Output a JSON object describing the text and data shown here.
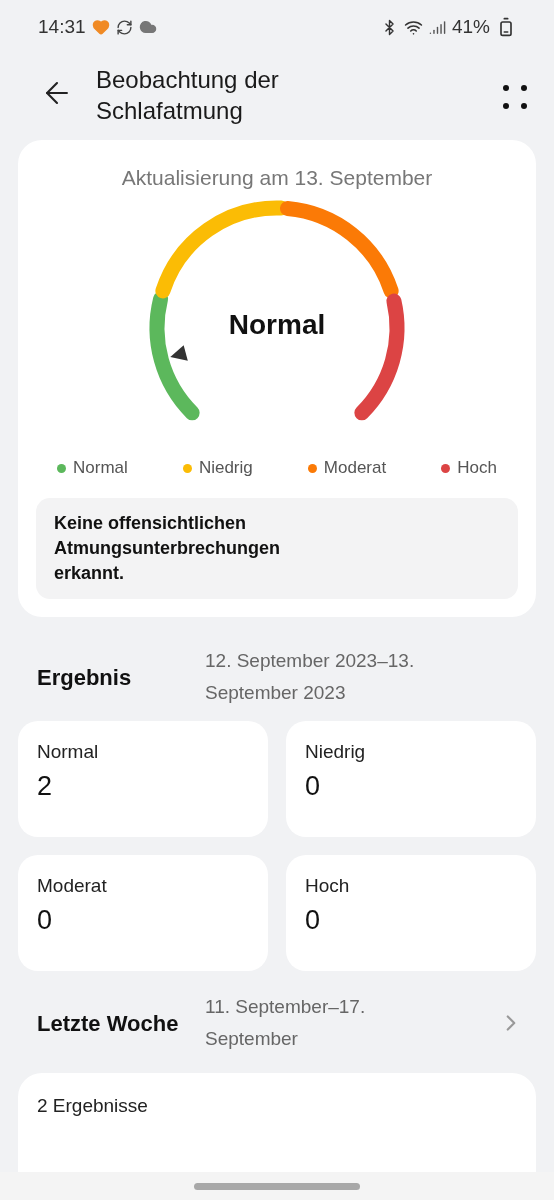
{
  "status_bar": {
    "time": "14:31",
    "battery": "41%"
  },
  "header": {
    "title": "Beobachtung der Schlafatmung"
  },
  "summary_card": {
    "updated": "Aktualisierung am 13. September",
    "gauge": {
      "label": "Normal"
    },
    "legend": [
      {
        "label": "Normal",
        "color": "#5cb85c"
      },
      {
        "label": "Niedrig",
        "color": "#fbbc05"
      },
      {
        "label": "Moderat",
        "color": "#fb7a06"
      },
      {
        "label": "Hoch",
        "color": "#dc4444"
      }
    ],
    "message": "Keine offensichtlichen Atmungsunterbrechungen erkannt."
  },
  "result": {
    "title": "Ergebnis",
    "date_range": "12. September 2023–13. September 2023",
    "tiles": [
      {
        "label": "Normal",
        "value": "2"
      },
      {
        "label": "Niedrig",
        "value": "0"
      },
      {
        "label": "Moderat",
        "value": "0"
      },
      {
        "label": "Hoch",
        "value": "0"
      }
    ]
  },
  "last_week": {
    "title": "Letzte Woche",
    "date_range": "11. September–17. September",
    "count": "2 Ergebnisse"
  }
}
